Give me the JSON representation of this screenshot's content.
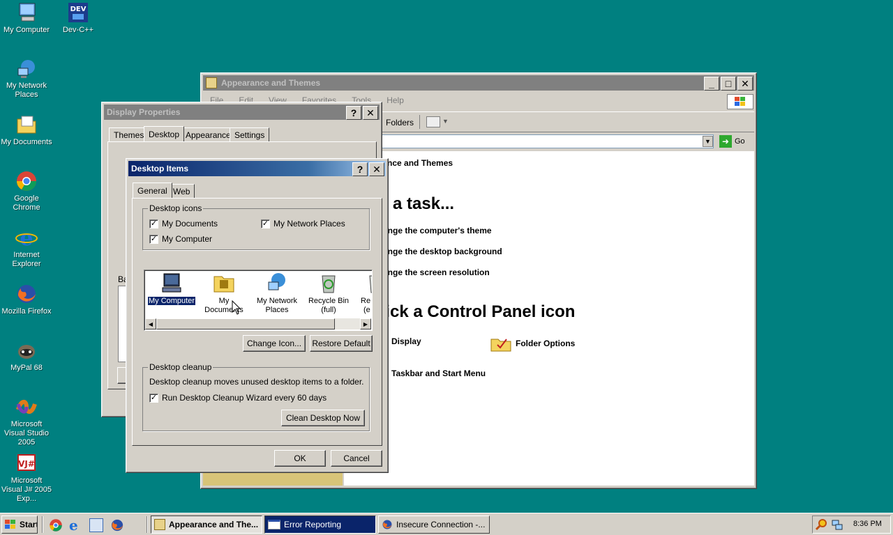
{
  "desktop": {
    "icons": [
      {
        "label": "My Computer",
        "icon": "my-computer-icon"
      },
      {
        "label": "Dev-C++",
        "icon": "devcpp-icon"
      },
      {
        "label": "My Network Places",
        "icon": "network-places-icon"
      },
      {
        "label": "My Documents",
        "icon": "my-documents-icon"
      },
      {
        "label": "Google Chrome",
        "icon": "chrome-icon"
      },
      {
        "label": "Internet Explorer",
        "icon": "ie-icon"
      },
      {
        "label": "Mozilla Firefox",
        "icon": "firefox-icon"
      },
      {
        "label": "MyPal 68",
        "icon": "mypal-icon"
      },
      {
        "label": "Microsoft Visual Studio 2005",
        "icon": "visual-studio-icon"
      },
      {
        "label": "Microsoft Visual J# 2005 Exp...",
        "icon": "visual-jsharp-icon"
      }
    ]
  },
  "explorer": {
    "title": "Appearance and Themes",
    "menu": [
      "File",
      "Edit",
      "View",
      "Favorites",
      "Tools",
      "Help"
    ],
    "toolbar": {
      "folders": "Folders",
      "go": "Go"
    },
    "breadcrumb": "Appearance and Themes",
    "pick_task": "Pick a task...",
    "tasks": [
      "Change the computer's theme",
      "Change the desktop background",
      "Change the screen resolution"
    ],
    "pick_icon": "or pick a Control Panel icon",
    "icons": [
      "Display",
      "Folder Options",
      "Taskbar and Start Menu"
    ]
  },
  "display_properties": {
    "title": "Display Properties",
    "tabs": [
      "Themes",
      "Desktop",
      "Appearance",
      "Settings"
    ],
    "background_label": "Ba"
  },
  "desktop_items": {
    "title": "Desktop Items",
    "tabs": [
      "General",
      "Web"
    ],
    "desktop_icons_group": "Desktop icons",
    "checks": [
      {
        "label": "My Documents",
        "checked": true
      },
      {
        "label": "My Network Places",
        "checked": true
      },
      {
        "label": "My Computer",
        "checked": true
      }
    ],
    "list": [
      "My Computer",
      "My Documents",
      "My Network Places",
      "Recycle Bin (full)",
      "Recycle Bin (empty)"
    ],
    "list_lines": [
      [
        "My Computer"
      ],
      [
        "My Documents"
      ],
      [
        "My Network",
        "Places"
      ],
      [
        "Recycle Bin",
        "(full)"
      ],
      [
        "Re",
        "(e"
      ]
    ],
    "change_icon": "Change Icon...",
    "restore_default": "Restore Default",
    "cleanup_group": "Desktop cleanup",
    "cleanup_desc": "Desktop cleanup moves unused desktop items to a folder.",
    "cleanup_check": "Run Desktop Cleanup Wizard every 60 days",
    "clean_now": "Clean Desktop Now",
    "ok": "OK",
    "cancel": "Cancel"
  },
  "taskbar": {
    "start": "Start",
    "tasks": [
      "Appearance and The...",
      "Error Reporting",
      "Insecure Connection -..."
    ],
    "clock": "8:36 PM"
  },
  "colors": {
    "desktop": "#008080",
    "active_title": "#0a246a",
    "inactive_title": "#808080",
    "face": "#d4d0c8"
  }
}
